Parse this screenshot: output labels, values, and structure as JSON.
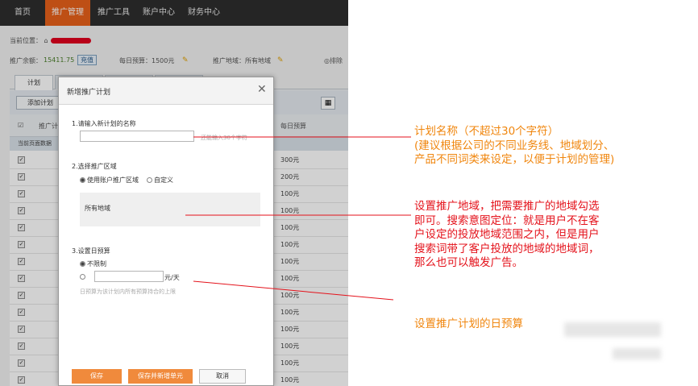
{
  "nav": [
    "首页",
    "推广管理",
    "推广工具",
    "账户中心",
    "财务中心"
  ],
  "breadcrumb": "当前位置：",
  "info": {
    "balance_label": "推广余额：",
    "balance_value": "15411.75",
    "recharge": "充值",
    "daily_budget": "每日预算：1500元",
    "region": "推广地域：所有地域",
    "right": "◎排除"
  },
  "tabs": [
    "计划"
  ],
  "toolbar": {
    "add_plan": "添加计划"
  },
  "table": {
    "col_plan": "推广计",
    "col_budget": "每日预算",
    "subhead": "当前页面数据",
    "rows": [
      {
        "budget": "300元"
      },
      {
        "budget": "200元"
      },
      {
        "budget": "100元"
      },
      {
        "budget": "100元"
      },
      {
        "budget": "100元"
      },
      {
        "budget": "100元"
      },
      {
        "budget": "100元"
      },
      {
        "budget": "100元"
      },
      {
        "budget": "100元"
      },
      {
        "budget": "100元"
      },
      {
        "budget": "100元"
      },
      {
        "budget": "100元"
      },
      {
        "budget": "100元"
      },
      {
        "budget": "100元"
      }
    ]
  },
  "modal": {
    "title": "新增推广计划",
    "close": "✕",
    "step1": "1.请输入新计划的名称",
    "step1_hint": "还能输入30个字符",
    "step2": "2.选择推广区域",
    "opt_account": "使用账户推广区域",
    "opt_custom": "自定义",
    "all_regions": "所有地域",
    "step3": "3.设置日预算",
    "opt_unlimited": "不限制",
    "unit": "元/天",
    "budget_hint": "日预算为该计划内所有预算持合的上限",
    "btn_save": "保存",
    "btn_save_add": "保存并新增单元",
    "btn_cancel": "取消"
  },
  "annotations": {
    "a1": [
      "计划名称（不超过30个字符）",
      "(建议根据公司的不同业务线、地域划分、",
      "产品不同词类来设定，以便于计划的管理)"
    ],
    "a2": [
      "设置推广地域，把需要推广的地域勾选",
      "即可。搜索意图定位：就是用户不在客",
      "户设定的投放地域范围之内，但是用户",
      "搜索词带了客户投放的地域的地域词，",
      "那么也可以触发广告。"
    ],
    "a3": "设置推广计划的日预算"
  }
}
